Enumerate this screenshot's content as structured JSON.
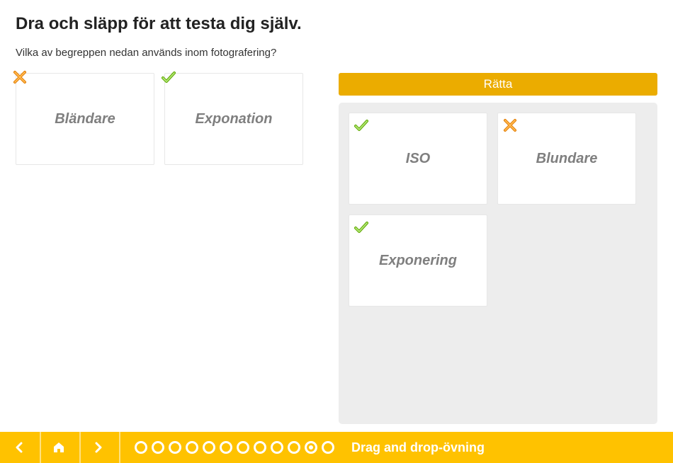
{
  "heading": "Dra och släpp för att testa dig själv.",
  "question": "Vilka av begreppen nedan används inom fotografering?",
  "checkButton": "Rätta",
  "sourceCards": [
    {
      "label": "Bländare",
      "mark": "wrong"
    },
    {
      "label": "Exponation",
      "mark": "correct"
    }
  ],
  "dropZoneCards": [
    {
      "label": "ISO",
      "mark": "correct"
    },
    {
      "label": "Blundare",
      "mark": "wrong"
    },
    {
      "label": "Exponering",
      "mark": "correct"
    }
  ],
  "nav": {
    "progressCount": 12,
    "activeIndex": 10,
    "title": "Drag and drop-övning"
  }
}
